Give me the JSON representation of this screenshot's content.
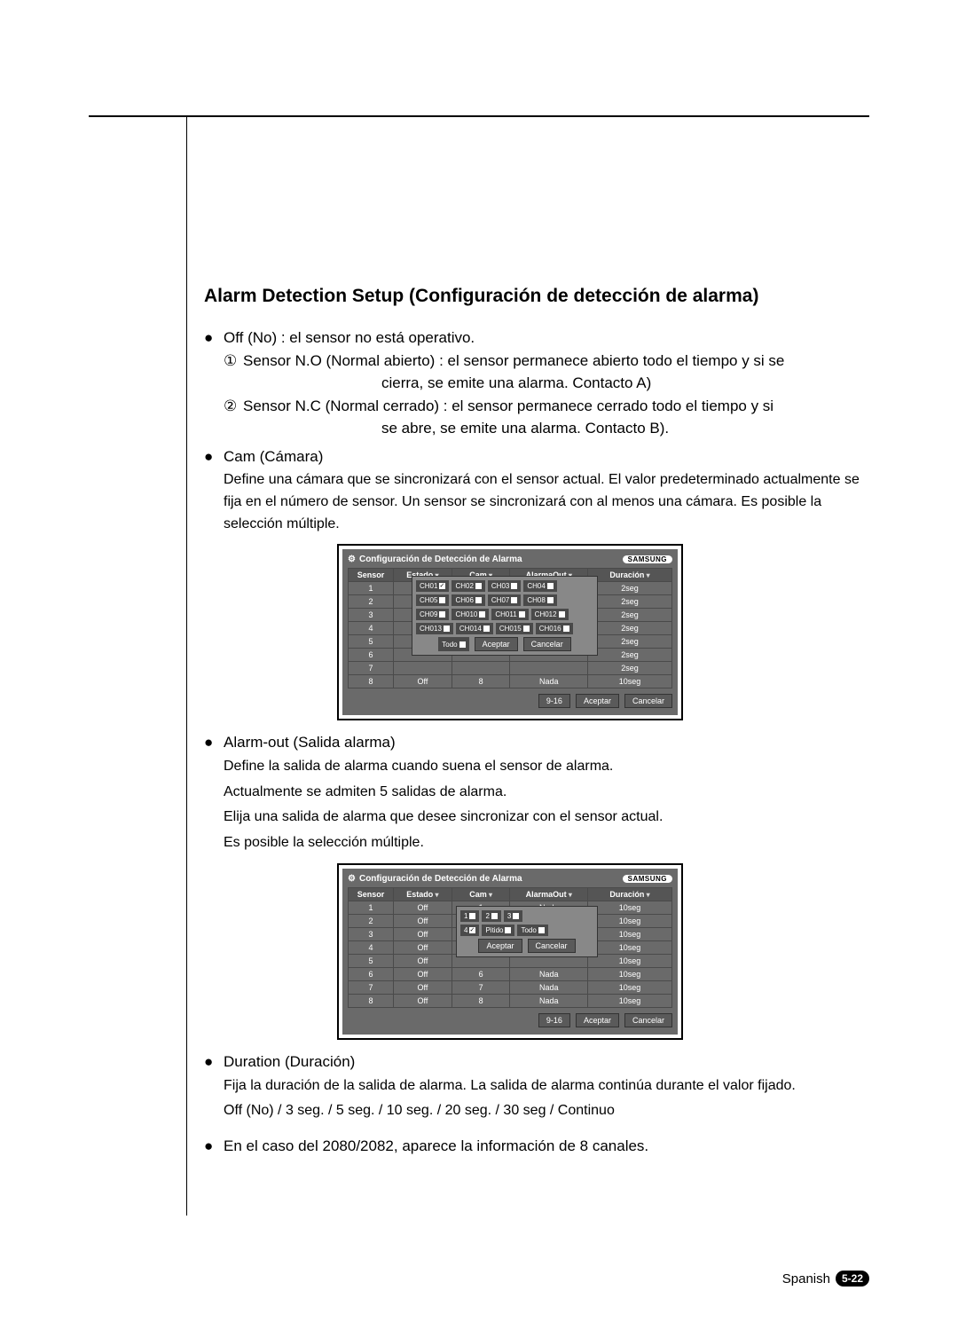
{
  "title": "Alarm Detection Setup (Configuración de detección de alarma)",
  "bullets": {
    "off": "Off (No) : el sensor no está operativo.",
    "sensor_no": "Sensor N.O (Normal abierto) : el sensor permanece abierto todo el tiempo y si se",
    "sensor_no2": "cierra, se emite una alarma. Contacto A)",
    "sensor_nc": "Sensor N.C (Normal cerrado) : el sensor permanece cerrado todo el tiempo y si",
    "sensor_nc2": "se abre, se emite una alarma. Contacto B).",
    "cam": "Cam (Cámara)",
    "cam_desc": "Define una cámara que se sincronizará con el sensor actual. El valor predeterminado actualmente se fija en el número de sensor. Un sensor se sincronizará con al menos una cámara. Es posible la selección múltiple.",
    "alarmout": "Alarm-out (Salida alarma)",
    "alarmout_d1": "Define la salida de alarma cuando suena el sensor de alarma.",
    "alarmout_d2": "Actualmente se admiten 5 salidas de alarma.",
    "alarmout_d3": "Elija una salida de alarma que desee sincronizar con el sensor actual.",
    "alarmout_d4": "Es posible la selección múltiple.",
    "duration": "Duration (Duración)",
    "duration_d1": "Fija la duración de la salida de alarma. La salida de alarma continúa durante el valor fijado.",
    "duration_d2": "Off (No) / 3 seg. / 5 seg. / 10 seg. / 20 seg. / 30 seg / Continuo",
    "note": "En el caso del 2080/2082, aparece la información de 8 canales."
  },
  "panel": {
    "title": "Configuración de Detección de Alarma",
    "logo": "SAMSUNG",
    "headers": {
      "sensor": "Sensor",
      "estado": "Estado",
      "cam": "Cam",
      "alarmout": "AlarmaOut",
      "duracion": "Duración"
    },
    "range_btn": "9-16",
    "accept": "Aceptar",
    "cancel": "Cancelar",
    "todo": "Todo",
    "pitido": "Pitido"
  },
  "panel1": {
    "rows": [
      {
        "sensor": "1",
        "dur": "2seg"
      },
      {
        "sensor": "2",
        "dur": "2seg"
      },
      {
        "sensor": "3",
        "dur": "2seg"
      },
      {
        "sensor": "4",
        "dur": "2seg"
      },
      {
        "sensor": "5",
        "dur": "2seg"
      },
      {
        "sensor": "6",
        "dur": "2seg"
      },
      {
        "sensor": "7",
        "dur": "2seg"
      },
      {
        "sensor": "8",
        "estado": "Off",
        "cam": "8",
        "ao": "Nada",
        "dur": "10seg"
      }
    ],
    "popup": {
      "rows": [
        [
          "CH01",
          "CH02",
          "CH03",
          "CH04"
        ],
        [
          "CH05",
          "CH06",
          "CH07",
          "CH08"
        ],
        [
          "CH09",
          "CH010",
          "CH011",
          "CH012"
        ],
        [
          "CH013",
          "CH014",
          "CH015",
          "CH016"
        ]
      ]
    }
  },
  "panel2": {
    "rows": [
      {
        "sensor": "1",
        "estado": "Off",
        "cam": "1",
        "ao": "Nada",
        "dur": "10seg"
      },
      {
        "sensor": "2",
        "estado": "Off",
        "cam": "",
        "ao": "",
        "dur": "10seg"
      },
      {
        "sensor": "3",
        "estado": "Off",
        "cam": "",
        "ao": "",
        "dur": "10seg"
      },
      {
        "sensor": "4",
        "estado": "Off",
        "cam": "",
        "ao": "",
        "dur": "10seg"
      },
      {
        "sensor": "5",
        "estado": "Off",
        "cam": "",
        "ao": "",
        "dur": "10seg"
      },
      {
        "sensor": "6",
        "estado": "Off",
        "cam": "6",
        "ao": "Nada",
        "dur": "10seg"
      },
      {
        "sensor": "7",
        "estado": "Off",
        "cam": "7",
        "ao": "Nada",
        "dur": "10seg"
      },
      {
        "sensor": "8",
        "estado": "Off",
        "cam": "8",
        "ao": "Nada",
        "dur": "10seg"
      }
    ],
    "popup_items": [
      "1",
      "2",
      "3",
      "4"
    ]
  },
  "footer": {
    "lang": "Spanish",
    "page": "5-22"
  }
}
